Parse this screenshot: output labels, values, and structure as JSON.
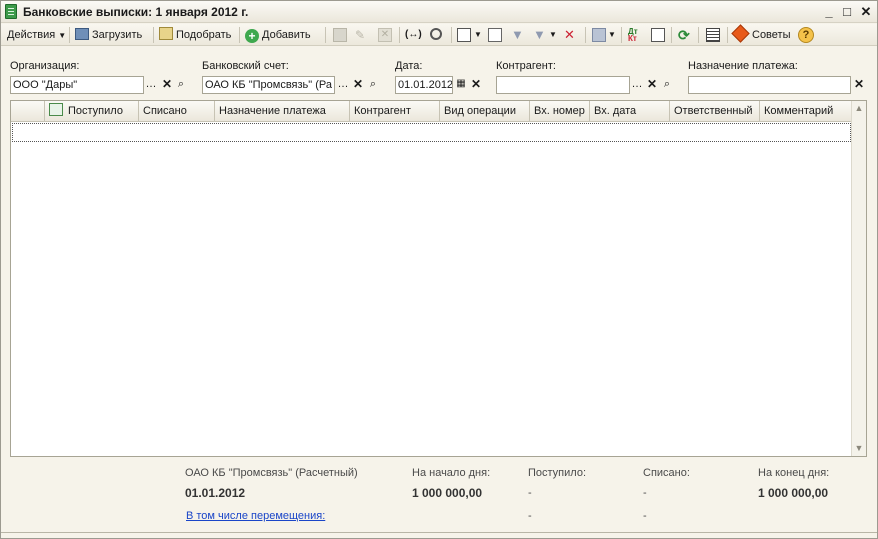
{
  "window": {
    "title": "Банковские выписки: 1 января 2012 г.",
    "minimize": "_",
    "maximize": "□",
    "close": "✕"
  },
  "toolbar": {
    "actions": "Действия",
    "load": "Загрузить",
    "pick": "Подобрать",
    "add": "Добавить",
    "tips": "Советы",
    "help": "?"
  },
  "filters": {
    "organization": {
      "label": "Организация:",
      "value": "ООО \"Дары\""
    },
    "bank_account": {
      "label": "Банковский счет:",
      "value": "ОАО КБ \"Промсвязь\" (Ра"
    },
    "date": {
      "label": "Дата:",
      "value": "01.01.2012"
    },
    "counterparty": {
      "label": "Контрагент:",
      "value": ""
    },
    "purpose": {
      "label": "Назначение платежа:",
      "value": ""
    }
  },
  "table": {
    "columns": [
      "Поступило",
      "Списано",
      "Назначение платежа",
      "Контрагент",
      "Вид операции",
      "Вх. номер",
      "Вх. дата",
      "Ответственный",
      "Комментарий"
    ],
    "active_column": "Поступило",
    "rows": []
  },
  "footer": {
    "account": "ОАО КБ \"Промсвязь\" (Расчетный)",
    "date": "01.01.2012",
    "start_label": "На начало дня:",
    "start_value": "1 000 000,00",
    "in_label": "Поступило:",
    "in_value": "-",
    "out_label": "Списано:",
    "out_value": "-",
    "end_label": "На конец дня:",
    "end_value": "1 000 000,00",
    "transfers_link": "В том числе перемещения:",
    "transfers_in": "-",
    "transfers_out": "-"
  }
}
